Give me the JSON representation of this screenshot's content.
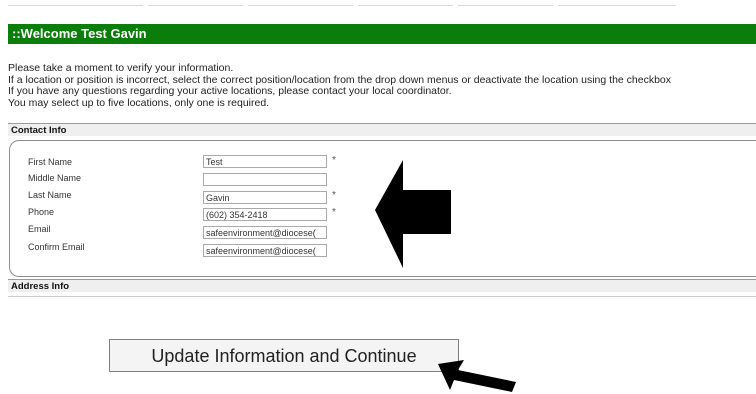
{
  "banner": {
    "title": "::Welcome Test Gavin"
  },
  "intro": {
    "lines": [
      "Please take a moment to verify your information.",
      "If a location or position is incorrect, select the correct position/location from the drop down menus or deactivate the location using the checkbox",
      "If you have any questions regarding your active locations, please contact your local coordinator.",
      "You may select up to five locations, only one is required."
    ]
  },
  "contact": {
    "header": "Contact Info",
    "required_mark": "*",
    "fields": [
      {
        "label": "First Name",
        "value": "Test",
        "required": true
      },
      {
        "label": "Middle Name",
        "value": "",
        "required": false
      },
      {
        "label": "Last Name",
        "value": "Gavin",
        "required": true
      },
      {
        "label": "Phone",
        "value": "(602) 354-2418",
        "required": true
      },
      {
        "label": "Email",
        "value": "safeenvironment@diocese(",
        "required": false
      },
      {
        "label": "Confirm Email",
        "value": "safeenvironment@diocese(",
        "required": false
      }
    ]
  },
  "address": {
    "header": "Address Info"
  },
  "actions": {
    "update_label": "Update Information and Continue"
  },
  "colors": {
    "banner": "#0a7d0a",
    "arrow": "#000000"
  }
}
